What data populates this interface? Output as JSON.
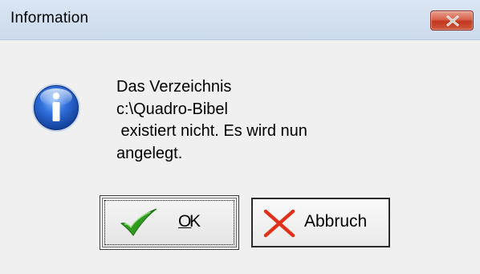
{
  "window": {
    "title": "Information"
  },
  "icons": {
    "close": "close-icon",
    "info": "info-icon",
    "ok": "checkmark-icon",
    "cancel": "cross-icon"
  },
  "message": {
    "lines": [
      "Das Verzeichnis",
      "c:\\Quadro-Bibel",
      " existiert nicht. Es wird nun",
      "angelegt."
    ]
  },
  "buttons": {
    "ok_mnemonic": "O",
    "ok_rest": "K",
    "cancel_label": "Abbruch"
  },
  "colors": {
    "titlebar": "#cbdaec",
    "close_button": "#c94a33",
    "info_blue": "#1f5cc4",
    "check_green": "#2f9a1f",
    "cross_red": "#e0321b"
  }
}
